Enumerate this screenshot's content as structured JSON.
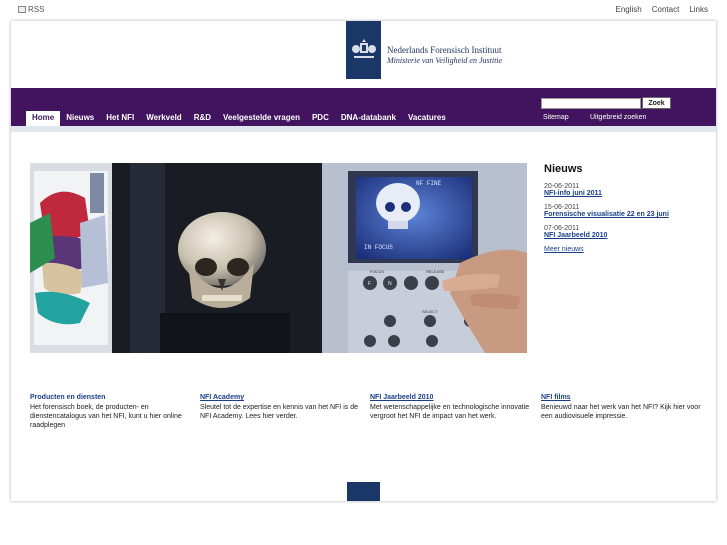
{
  "topbar": {
    "rss_label": "RSS",
    "links": [
      "English",
      "Contact",
      "Links"
    ]
  },
  "header": {
    "logo_title": "Nederlands Forensisch Instituut",
    "logo_subtitle": "Ministerie van Veiligheid en Justitie",
    "brand_color": "#1a3767"
  },
  "nav": {
    "color": "#42145f",
    "items": [
      "Home",
      "Nieuws",
      "Het NFI",
      "Werkveld",
      "R&D",
      "Veelgestelde vragen",
      "PDC",
      "DNA-databank",
      "Vacatures"
    ],
    "active": "Home"
  },
  "search": {
    "value": "",
    "button": "Zoek",
    "sitemap": "Sitemap",
    "advanced": "Uitgebreid zoeken"
  },
  "news": {
    "title": "Nieuws",
    "items": [
      {
        "date": "20-06-2011",
        "title": "NFI-info juni 2011"
      },
      {
        "date": "15-06-2011",
        "title": "Forensische visualisatie 22 en 23 juni"
      },
      {
        "date": "07-06-2011",
        "title": "NFI Jaarbeeld 2010"
      }
    ],
    "more": "Meer nieuws"
  },
  "hero": {
    "screen_text_top": "NF FINE",
    "screen_text_bottom": "IN FOCUS",
    "key_focus": "FOCUS",
    "key_f": "F",
    "key_n": "N",
    "key_release": "RELEASE",
    "key_select": "SELECT"
  },
  "features": [
    {
      "title": "Producten en diensten",
      "text": "Het forensisch boek, de producten- en dienstencatalogus van het NFI, kunt u hier online raadplegen"
    },
    {
      "title": "NFI Academy",
      "text": "Sleutel tot de expertise en kennis van het NFI is de NFI Academy. Lees hier verder."
    },
    {
      "title": "NFI Jaarbeeld 2010",
      "text": "Met wetenschappelijke en technologische innovatie vergroot het NFI de impact van het werk."
    },
    {
      "title": "NFI films",
      "text": "Benieuwd naar het werk van het NFI? Kijk hier voor een audiovisuele impressie."
    }
  ]
}
